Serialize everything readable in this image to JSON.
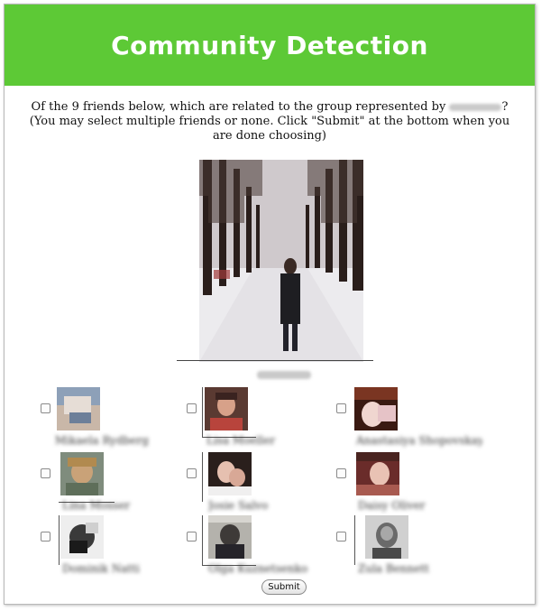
{
  "header": {
    "title": "Community Detection",
    "color": "#5dc936"
  },
  "question": {
    "line1_before": "Of the 9 friends below, which are related to the group represented by",
    "line1_after": "?",
    "line2": "(You may select multiple friends or none. Click \"Submit\" at the bottom when you are done choosing)"
  },
  "main_photo": {
    "icon": "person-in-snow-photo"
  },
  "friends": [
    {
      "icon": "friend-photo"
    },
    {
      "icon": "friend-photo"
    },
    {
      "icon": "friend-photo"
    },
    {
      "icon": "friend-photo"
    },
    {
      "icon": "friend-photo"
    },
    {
      "icon": "friend-photo"
    },
    {
      "icon": "friend-photo"
    },
    {
      "icon": "friend-photo"
    },
    {
      "icon": "friend-photo"
    }
  ],
  "submit": {
    "label": "Submit"
  }
}
